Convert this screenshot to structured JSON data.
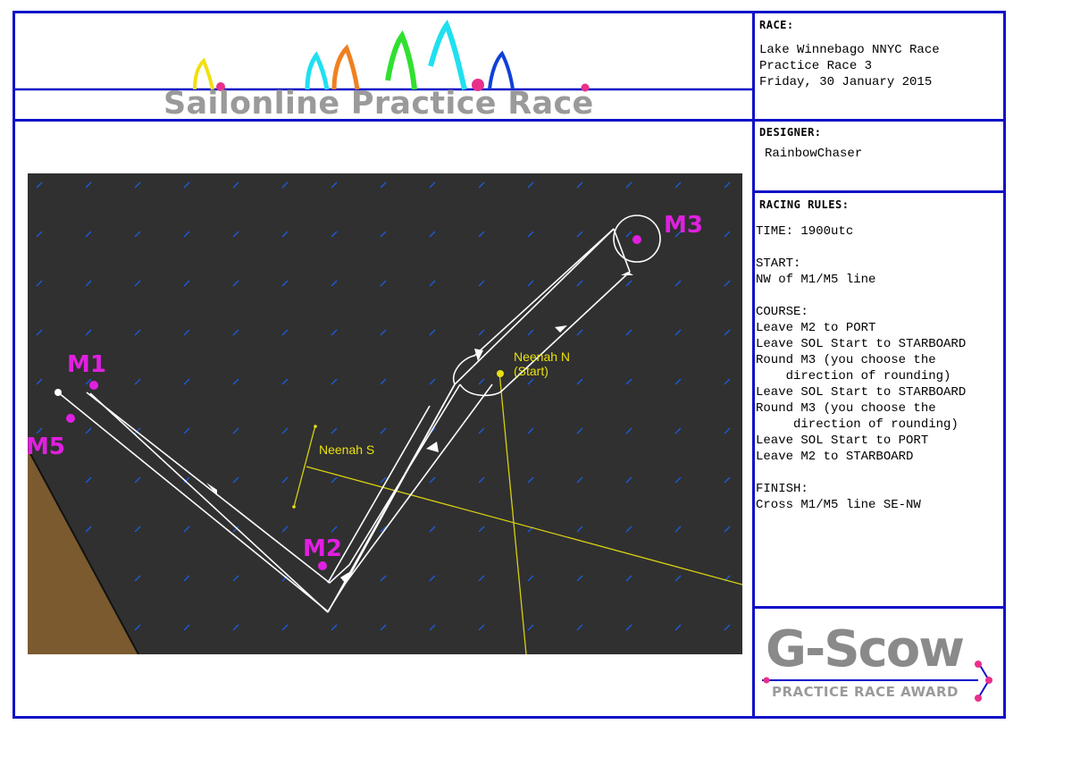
{
  "header": {
    "title": "Sailonline Practice Race"
  },
  "race": {
    "heading": "RACE:",
    "lines": [
      "Lake Winnebago NNYC Race",
      "Practice Race 3",
      "Friday, 30 January 2015"
    ]
  },
  "designer": {
    "heading": "DESIGNER:",
    "name": "RainbowChaser"
  },
  "rules": {
    "heading": "RACING RULES:",
    "time": "TIME: 1900utc",
    "start_heading": "START:",
    "start": "NW of M1/M5 line",
    "course_heading": "COURSE:",
    "course": [
      "Leave M2 to PORT",
      "Leave SOL Start to STARBOARD",
      "Round M3 (you choose the",
      "    direction of rounding)",
      "Leave SOL Start to STARBOARD",
      "Round M3 (you choose the",
      "     direction of rounding)",
      "Leave SOL Start to PORT",
      "Leave M2 to STARBOARD"
    ],
    "finish_heading": "FINISH:",
    "finish": "Cross M1/M5 line SE-NW"
  },
  "map": {
    "marks": [
      {
        "id": "M1",
        "label": "M1"
      },
      {
        "id": "M2",
        "label": "M2"
      },
      {
        "id": "M3",
        "label": "M3"
      },
      {
        "id": "M5",
        "label": "M5"
      }
    ],
    "waypoints": [
      {
        "label": "Neenah N",
        "sublabel": "(Start)"
      },
      {
        "label": "Neenah S"
      }
    ],
    "colors": {
      "water": "#303030",
      "land": "#7a5a2e",
      "route": "#ffffff",
      "marks": "#e020e0",
      "waypoints": "#e8e010",
      "wind_arrows": "#1a5ad8"
    }
  },
  "award": {
    "title": "G-Scow",
    "subtitle": "PRACTICE RACE AWARD"
  },
  "colors": {
    "border": "#1010c8",
    "accent_pink": "#e8308a"
  }
}
